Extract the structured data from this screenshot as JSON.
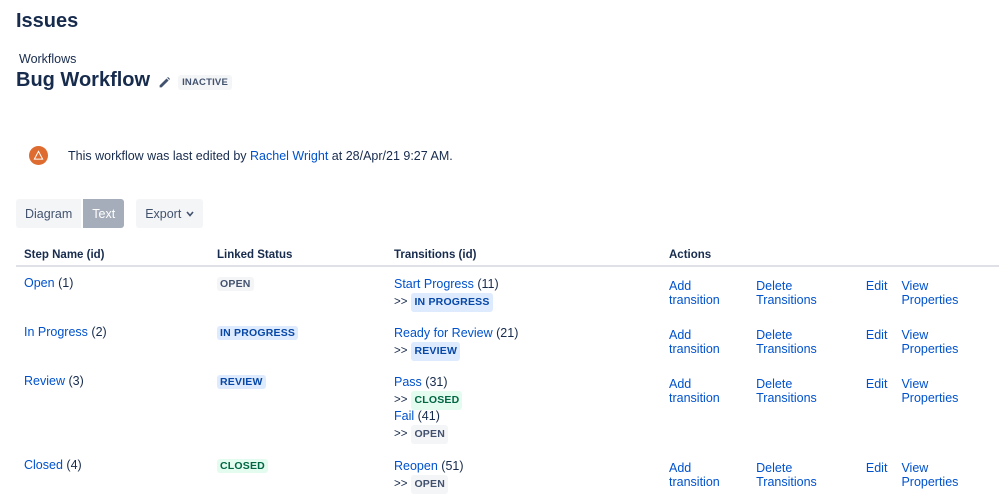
{
  "header": {
    "title": "Issues"
  },
  "breadcrumb": "Workflows",
  "workflow": {
    "name": "Bug Workflow",
    "badge": "INACTIVE"
  },
  "edited": {
    "prefix": "This workflow was last edited by",
    "user": "Rachel Wright",
    "suffix": "at 28/Apr/21 9:27 AM."
  },
  "toolbar": {
    "diagram": "Diagram",
    "text": "Text",
    "export": "Export"
  },
  "columns": [
    "Step Name (id)",
    "Linked Status",
    "Transitions (id)",
    "Actions"
  ],
  "actions": [
    "Add transition",
    "Delete Transitions",
    "Edit",
    "View Properties"
  ],
  "arrow": ">>",
  "steps": [
    {
      "name": "Open",
      "id": "(1)",
      "status": "OPEN",
      "transitions": [
        {
          "name": "Start Progress",
          "id": "(11)",
          "target": "IN PROGRESS"
        }
      ]
    },
    {
      "name": "In Progress",
      "id": "(2)",
      "status": "IN PROGRESS",
      "transitions": [
        {
          "name": "Ready for Review",
          "id": "(21)",
          "target": "REVIEW"
        }
      ]
    },
    {
      "name": "Review",
      "id": "(3)",
      "status": "REVIEW",
      "transitions": [
        {
          "name": "Pass",
          "id": "(31)",
          "target": "CLOSED"
        },
        {
          "name": "Fail",
          "id": "(41)",
          "target": "OPEN"
        }
      ]
    },
    {
      "name": "Closed",
      "id": "(4)",
      "status": "CLOSED",
      "transitions": [
        {
          "name": "Reopen",
          "id": "(51)",
          "target": "OPEN"
        }
      ]
    }
  ],
  "colors": {
    "link": "#0052cc",
    "text": "#172b4d",
    "avatar": "#de6b2f",
    "lozenge_blue": "#deebff",
    "lozenge_green": "#e3fcef"
  }
}
